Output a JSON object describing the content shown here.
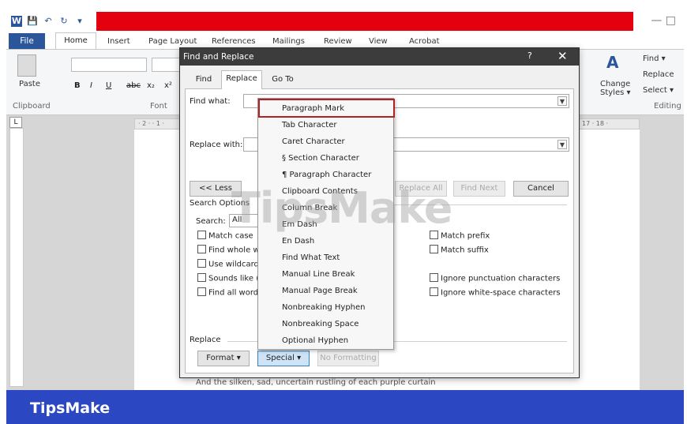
{
  "app": {
    "quick_access": [
      "W",
      "💾",
      "↶",
      "↻",
      "▾"
    ],
    "window_controls": "— □",
    "tabs": [
      "File",
      "Home",
      "Insert",
      "Page Layout",
      "References",
      "Mailings",
      "Review",
      "View",
      "Acrobat"
    ],
    "ribbon": {
      "paste_label": "Paste",
      "clipboard_label": "Clipboard",
      "font_label": "Font",
      "bold": "B",
      "italic": "I",
      "underline": "U",
      "strike": "abc",
      "subscript": "x₂",
      "superscript": "x²",
      "styles_label": "Change Styles ▾",
      "find_label": "Find ▾",
      "replace_label": "Replace",
      "select_label": "Select ▾",
      "editing_label": "Editing"
    },
    "ruler_marks": "· 2 · · 1 ·",
    "ruler_right": "17 · 18 ·",
    "doc_text": "And the silken, sad, uncertain rustling of each purple curtain",
    "brand_color": "#2b579a",
    "accent_red": "#e4000f"
  },
  "dialog": {
    "title": "Find and Replace",
    "help": "?",
    "close": "✕",
    "tabs": [
      "Find",
      "Replace",
      "Go To"
    ],
    "active_tab": "Replace",
    "find_what_label": "Find what:",
    "replace_with_label": "Replace with:",
    "less_button": "<< Less",
    "replace_all_button": "Replace All",
    "find_next_button": "Find Next",
    "cancel_button": "Cancel",
    "search_options_label": "Search Options",
    "search_label": "Search:",
    "search_value": "All",
    "checkboxes_left": [
      "Match case",
      "Find whole wo",
      "Use wildcards",
      "Sounds like (E",
      "Find all word f"
    ],
    "checkboxes_right": [
      "Match prefix",
      "Match suffix",
      "Ignore punctuation characters",
      "Ignore white-space characters"
    ],
    "replace_label": "Replace",
    "format_button": "Format ▾",
    "special_button": "Special ▾",
    "no_formatting_button": "No Formatting"
  },
  "special_menu": {
    "items": [
      "Paragraph Mark",
      "Tab Character",
      "Caret Character",
      "§ Section Character",
      "¶ Paragraph Character",
      "Clipboard Contents",
      "Column Break",
      "Em Dash",
      "En Dash",
      "Find What Text",
      "Manual Line Break",
      "Manual Page Break",
      "Nonbreaking Hyphen",
      "Nonbreaking Space",
      "Optional Hyphen"
    ],
    "highlighted": "Paragraph Mark",
    "highlight_color": "#b32223"
  },
  "watermark": "TipsMake",
  "footer": {
    "brand": "TipsMake",
    "color": "#2b48c2"
  }
}
